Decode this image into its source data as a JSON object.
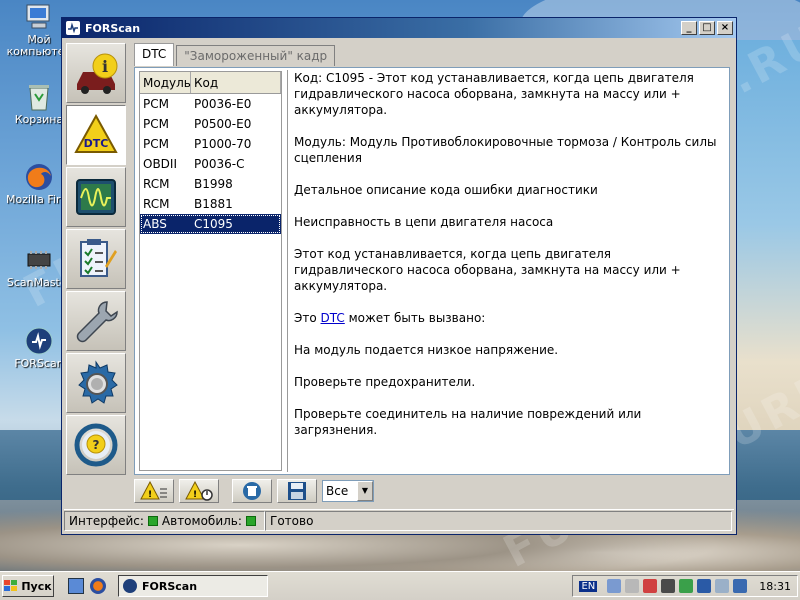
{
  "desktop": {
    "icons": [
      {
        "label": "Мой компьютер"
      },
      {
        "label": "Корзина"
      },
      {
        "label": "Mozilla Firefox"
      },
      {
        "label": "ScanMaster"
      },
      {
        "label": "FORScan"
      }
    ]
  },
  "window": {
    "title": "FORScan",
    "controls": {
      "minimize": "_",
      "maximize": "□",
      "close": "×"
    }
  },
  "nav": {
    "buttons": [
      {
        "name": "info-icon"
      },
      {
        "name": "dtc-icon",
        "label": "DTC"
      },
      {
        "name": "oscilloscope-icon"
      },
      {
        "name": "checklist-icon"
      },
      {
        "name": "wrench-icon"
      },
      {
        "name": "settings-gear-icon"
      },
      {
        "name": "help-wheel-icon"
      }
    ],
    "active_index": 1
  },
  "tabs": [
    {
      "label": "DTC",
      "active": true
    },
    {
      "label": "\"Замороженный\" кадр",
      "active": false
    }
  ],
  "dtc_list": {
    "headers": {
      "module": "Модуль",
      "code": "Код"
    },
    "rows": [
      {
        "module": "PCM",
        "code": "P0036-E0"
      },
      {
        "module": "PCM",
        "code": "P0500-E0"
      },
      {
        "module": "PCM",
        "code": "P1000-70"
      },
      {
        "module": "OBDII",
        "code": "P0036-C"
      },
      {
        "module": "RCM",
        "code": "B1998"
      },
      {
        "module": "RCM",
        "code": "B1881"
      },
      {
        "module": "ABS",
        "code": "C1095"
      }
    ],
    "selected_index": 6
  },
  "description": {
    "p1": "Код: C1095 - Этот код устанавливается, когда цепь двигателя гидравлического насоса оборвана, замкнута на массу или + аккумулятора.",
    "p2": "Модуль: Модуль Противоблокировочные тормоза / Контроль силы сцепления",
    "p3": "Детальное описание кода ошибки диагностики",
    "p4": "Неисправность в цепи двигателя насоса",
    "p5": "Этот код устанавливается, когда цепь двигателя гидравлического насоса оборвана, замкнута на массу или + аккумулятора.",
    "p6_before": "Это ",
    "p6_link": "DTC",
    "p6_after": " может быть вызвано:",
    "p7": "На модуль подается низкое напряжение.",
    "p8": "Проверьте предохранители.",
    "p9": "Проверьте соединитель на наличие повреждений или загрязнения."
  },
  "toolbar": {
    "buttons": [
      "read-dtc-button",
      "clear-dtc-button",
      "delete-button",
      "save-button"
    ],
    "filter": {
      "selected": "Все"
    }
  },
  "status": {
    "interface_label": "Интерфейс:",
    "vehicle_label": "Автомобиль:",
    "ready_text": "Готово",
    "led_color": "#2aa52a"
  },
  "taskbar": {
    "start_label": "Пуск",
    "task_title": "FORScan",
    "lang": "EN",
    "clock": "18:31"
  },
  "watermark": "FUSIONGURU.RU"
}
